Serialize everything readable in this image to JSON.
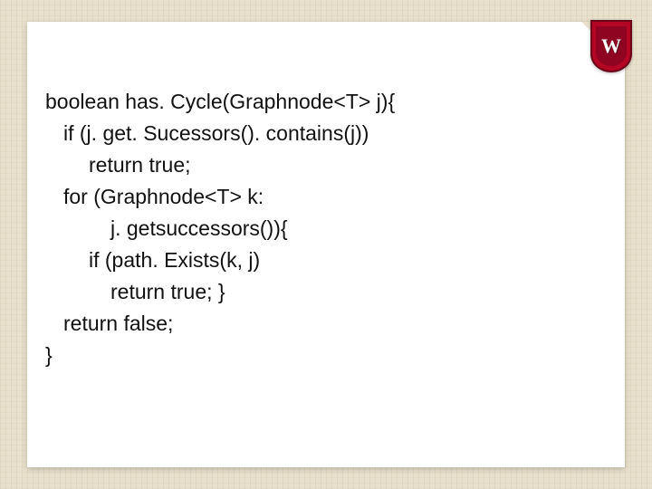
{
  "crest": {
    "letter": "W"
  },
  "code": {
    "line1": "boolean has. Cycle(Graphnode<T> j){",
    "line2": "if (j. get. Sucessors(). contains(j))",
    "line3": "return true;",
    "line4": "for (Graphnode<T> k:",
    "line5": "j. getsuccessors()){",
    "line6": "if (path. Exists(k, j)",
    "line7": "return true; }",
    "line8": "return false;",
    "line9": "}"
  }
}
